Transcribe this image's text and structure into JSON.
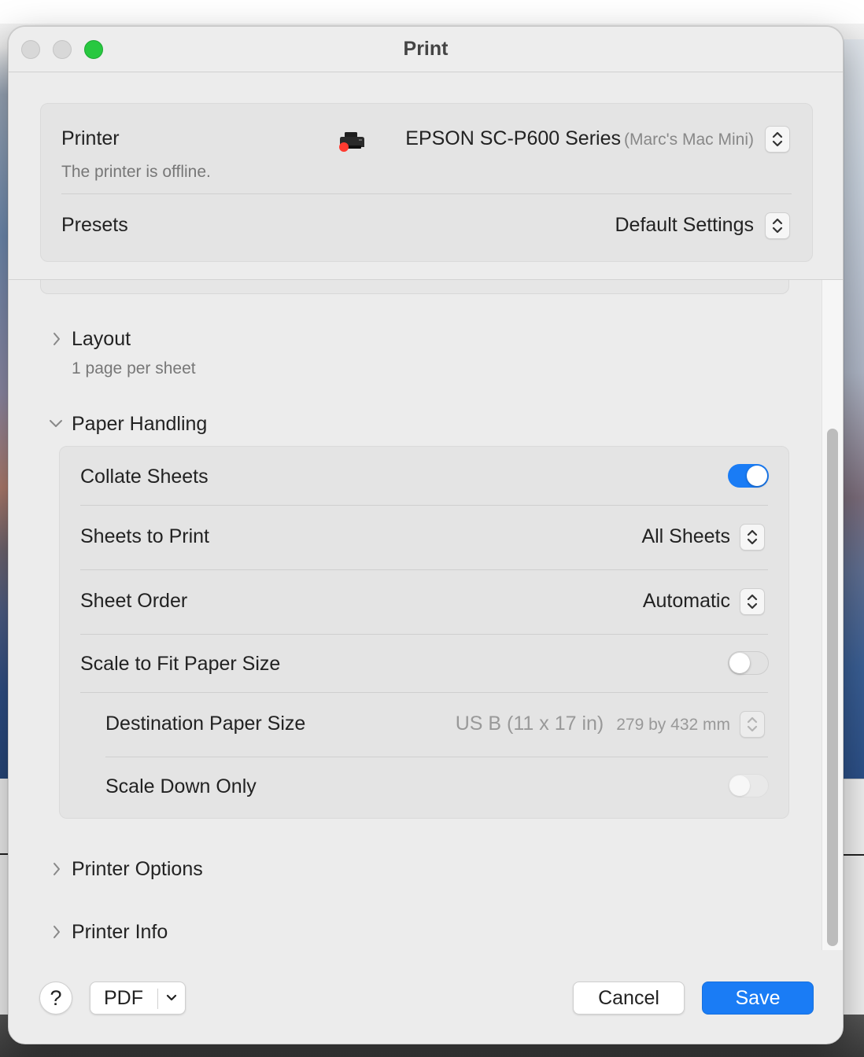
{
  "window": {
    "title": "Print"
  },
  "printer": {
    "label": "Printer",
    "status": "The printer is offline.",
    "name": "EPSON SC-P600 Series",
    "host": "(Marc's Mac Mini)"
  },
  "presets": {
    "label": "Presets",
    "value": "Default Settings"
  },
  "layout": {
    "title": "Layout",
    "summary": "1 page per sheet",
    "expanded": false
  },
  "paper_handling": {
    "title": "Paper Handling",
    "expanded": true,
    "collate": {
      "label": "Collate Sheets",
      "on": true
    },
    "sheets_to_print": {
      "label": "Sheets to Print",
      "value": "All Sheets"
    },
    "sheet_order": {
      "label": "Sheet Order",
      "value": "Automatic"
    },
    "scale_to_fit": {
      "label": "Scale to Fit Paper Size",
      "on": false
    },
    "destination": {
      "label": "Destination Paper Size",
      "value": "US B (11 x 17 in)",
      "dims": "279 by 432 mm"
    },
    "scale_down": {
      "label": "Scale Down Only",
      "on": false
    }
  },
  "printer_options": {
    "title": "Printer Options"
  },
  "printer_info": {
    "title": "Printer Info"
  },
  "buttons": {
    "help": "?",
    "pdf": "PDF",
    "cancel": "Cancel",
    "save": "Save"
  },
  "colors": {
    "accent": "#1a7cf5",
    "offline_dot": "#ff3b30",
    "zoom_button": "#28c840"
  }
}
